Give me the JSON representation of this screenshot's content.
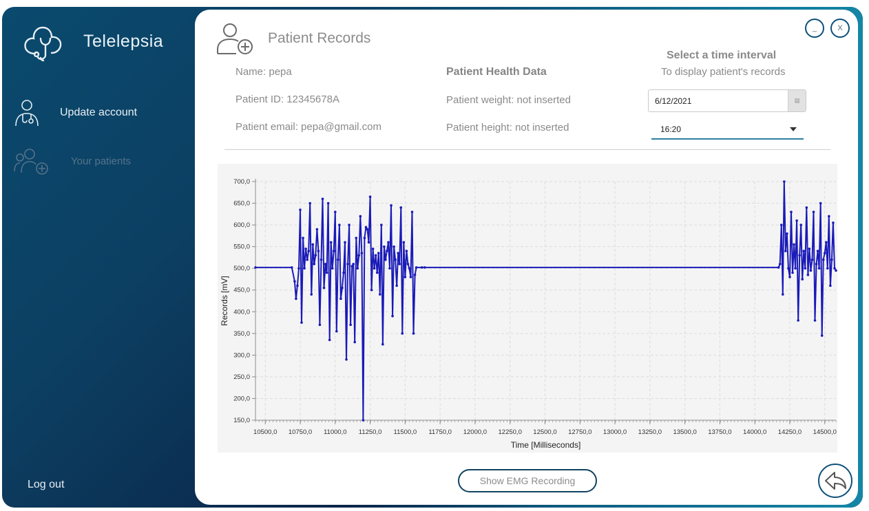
{
  "app": {
    "name": "Telelepsia",
    "logo_icon": "cloud-stethoscope-icon"
  },
  "sidebar": {
    "items": [
      {
        "label": "Update account",
        "icon": "doctor-icon",
        "active": true
      },
      {
        "label": "Your patients",
        "icon": "add-patients-icon",
        "active": false
      }
    ],
    "logout_label": "Log out"
  },
  "window": {
    "minimize_label": "_",
    "close_label": "X"
  },
  "header": {
    "title": "Patient Records",
    "icon": "add-user-icon"
  },
  "patient": {
    "name": "Name: pepa",
    "id": "Patient ID: 12345678A",
    "email": "Patient email: pepa@gmail.com"
  },
  "health": {
    "heading": "Patient Health Data",
    "weight": "Patient weight: not inserted",
    "height": "Patient height: not inserted"
  },
  "interval": {
    "heading": "Select a time interval",
    "subheading": "To display patient's records",
    "date_value": "6/12/2021",
    "time_value": "16:20"
  },
  "buttons": {
    "emg": "Show EMG Recording",
    "back_icon": "back-arrow-icon"
  },
  "colors": {
    "series": "#1a1ab8",
    "sidebar_dark": "#06102a",
    "accent": "#1486a6"
  },
  "chart_data": {
    "type": "line",
    "xlabel": "Time [Milliseconds]",
    "ylabel": "Records [mV]",
    "xlim": [
      10430,
      14580
    ],
    "ylim": [
      150,
      700
    ],
    "x_ticks": [
      "10500,0",
      "10750,0",
      "11000,0",
      "11250,0",
      "11500,0",
      "11750,0",
      "12000,0",
      "12250,0",
      "12500,0",
      "12750,0",
      "13000,0",
      "13250,0",
      "13500,0",
      "13750,0",
      "14000,0",
      "14250,0",
      "14500,0"
    ],
    "y_ticks": [
      "150,0",
      "200,0",
      "250,0",
      "300,0",
      "350,0",
      "400,0",
      "450,0",
      "500,0",
      "550,0",
      "600,0",
      "650,0",
      "700,0"
    ],
    "grid": true,
    "series": [
      {
        "points": [
          [
            10430,
            502
          ],
          [
            10690,
            502
          ],
          [
            10710,
            470
          ],
          [
            10720,
            430
          ],
          [
            10730,
            460
          ],
          [
            10740,
            500
          ],
          [
            10750,
            635
          ],
          [
            10760,
            375
          ],
          [
            10770,
            570
          ],
          [
            10780,
            500
          ],
          [
            10790,
            545
          ],
          [
            10800,
            520
          ],
          [
            10810,
            540
          ],
          [
            10820,
            650
          ],
          [
            10830,
            440
          ],
          [
            10840,
            555
          ],
          [
            10850,
            510
          ],
          [
            10860,
            530
          ],
          [
            10870,
            590
          ],
          [
            10880,
            540
          ],
          [
            10890,
            370
          ],
          [
            10900,
            520
          ],
          [
            10910,
            660
          ],
          [
            10920,
            455
          ],
          [
            10930,
            510
          ],
          [
            10940,
            490
          ],
          [
            10950,
            650
          ],
          [
            10960,
            335
          ],
          [
            10970,
            560
          ],
          [
            10980,
            500
          ],
          [
            10990,
            540
          ],
          [
            11000,
            630
          ],
          [
            11010,
            355
          ],
          [
            11020,
            520
          ],
          [
            11030,
            600
          ],
          [
            11040,
            430
          ],
          [
            11050,
            455
          ],
          [
            11060,
            490
          ],
          [
            11070,
            560
          ],
          [
            11080,
            290
          ],
          [
            11090,
            510
          ],
          [
            11100,
            600
          ],
          [
            11110,
            370
          ],
          [
            11120,
            505
          ],
          [
            11130,
            510
          ],
          [
            11140,
            330
          ],
          [
            11150,
            570
          ],
          [
            11160,
            500
          ],
          [
            11170,
            530
          ],
          [
            11180,
            620
          ],
          [
            11190,
            535
          ],
          [
            11200,
            150
          ],
          [
            11210,
            570
          ],
          [
            11220,
            595
          ],
          [
            11230,
            590
          ],
          [
            11240,
            560
          ],
          [
            11250,
            665
          ],
          [
            11260,
            450
          ],
          [
            11270,
            545
          ],
          [
            11280,
            500
          ],
          [
            11290,
            530
          ],
          [
            11300,
            490
          ],
          [
            11310,
            535
          ],
          [
            11320,
            440
          ],
          [
            11330,
            600
          ],
          [
            11340,
            325
          ],
          [
            11350,
            550
          ],
          [
            11360,
            520
          ],
          [
            11370,
            540
          ],
          [
            11380,
            560
          ],
          [
            11390,
            500
          ],
          [
            11400,
            645
          ],
          [
            11410,
            390
          ],
          [
            11420,
            550
          ],
          [
            11430,
            520
          ],
          [
            11440,
            460
          ],
          [
            11450,
            535
          ],
          [
            11460,
            510
          ],
          [
            11470,
            640
          ],
          [
            11480,
            350
          ],
          [
            11490,
            560
          ],
          [
            11500,
            480
          ],
          [
            11510,
            540
          ],
          [
            11520,
            510
          ],
          [
            11530,
            500
          ],
          [
            11540,
            480
          ],
          [
            11550,
            630
          ],
          [
            11560,
            350
          ],
          [
            11570,
            485
          ],
          [
            11580,
            502
          ],
          [
            11620,
            502
          ],
          [
            11640,
            502
          ],
          [
            14170,
            502
          ],
          [
            14180,
            510
          ],
          [
            14190,
            600
          ],
          [
            14200,
            440
          ],
          [
            14210,
            700
          ],
          [
            14220,
            540
          ],
          [
            14230,
            580
          ],
          [
            14240,
            500
          ],
          [
            14250,
            480
          ],
          [
            14260,
            630
          ],
          [
            14270,
            490
          ],
          [
            14280,
            555
          ],
          [
            14290,
            500
          ],
          [
            14300,
            610
          ],
          [
            14310,
            380
          ],
          [
            14320,
            530
          ],
          [
            14330,
            600
          ],
          [
            14340,
            475
          ],
          [
            14350,
            540
          ],
          [
            14360,
            500
          ],
          [
            14370,
            640
          ],
          [
            14380,
            485
          ],
          [
            14390,
            545
          ],
          [
            14400,
            495
          ],
          [
            14410,
            520
          ],
          [
            14420,
            630
          ],
          [
            14430,
            380
          ],
          [
            14440,
            510
          ],
          [
            14450,
            540
          ],
          [
            14460,
            500
          ],
          [
            14470,
            650
          ],
          [
            14480,
            345
          ],
          [
            14490,
            520
          ],
          [
            14500,
            535
          ],
          [
            14510,
            560
          ],
          [
            14520,
            500
          ],
          [
            14530,
            620
          ],
          [
            14540,
            460
          ],
          [
            14550,
            520
          ],
          [
            14560,
            605
          ],
          [
            14570,
            500
          ],
          [
            14580,
            495
          ]
        ]
      }
    ]
  }
}
